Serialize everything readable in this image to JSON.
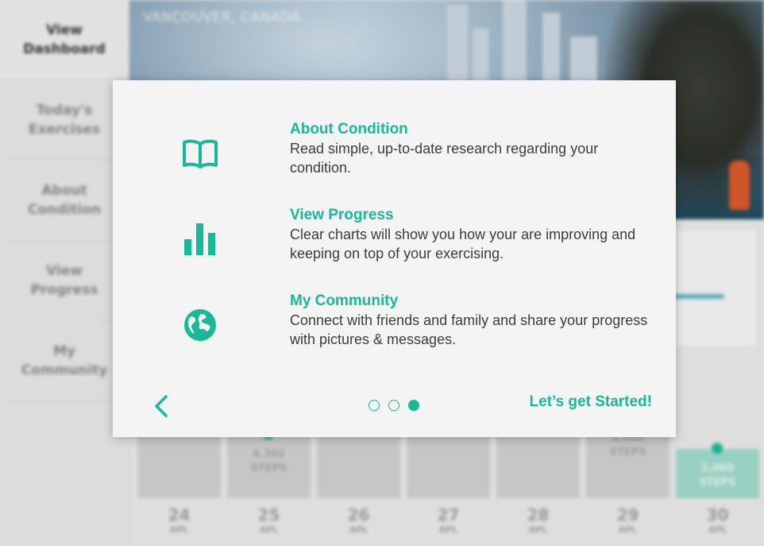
{
  "sidebar": {
    "items": [
      {
        "label": "View Dashboard",
        "active": true
      },
      {
        "label": "Today's Exercises"
      },
      {
        "label": "About Condition"
      },
      {
        "label": "View Progress"
      },
      {
        "label": "My Community"
      }
    ]
  },
  "hero": {
    "caption": "VANCOUVER, CANADA"
  },
  "days": [
    {
      "num": "24",
      "month": "APL",
      "steps": "",
      "steps_unit": ""
    },
    {
      "num": "25",
      "month": "APL",
      "steps": "4,302",
      "steps_unit": "STEPS"
    },
    {
      "num": "26",
      "month": "APL",
      "steps": "",
      "steps_unit": ""
    },
    {
      "num": "27",
      "month": "APL",
      "steps": "",
      "steps_unit": ""
    },
    {
      "num": "28",
      "month": "APL",
      "steps": "",
      "steps_unit": ""
    },
    {
      "num": "29",
      "month": "APL",
      "steps": "3,900",
      "steps_unit": "STEPS"
    },
    {
      "num": "30",
      "month": "APL",
      "steps": "2,060",
      "steps_unit": "STEPS",
      "today": true
    }
  ],
  "modal": {
    "features": [
      {
        "icon": "book-icon",
        "title": "About Condition",
        "desc": "Read simple, up-to-date research regarding your condition."
      },
      {
        "icon": "bar-chart-icon",
        "title": "View Progress",
        "desc": "Clear charts will show you how your are improving and keeping on top of your exercising."
      },
      {
        "icon": "globe-icon",
        "title": "My Community",
        "desc": "Connect with friends and family and share your progress with pictures & messages."
      }
    ],
    "pager": {
      "count": 3,
      "active_index": 2
    },
    "start_label": "Let’s get Started!",
    "accent": "#19b998"
  }
}
